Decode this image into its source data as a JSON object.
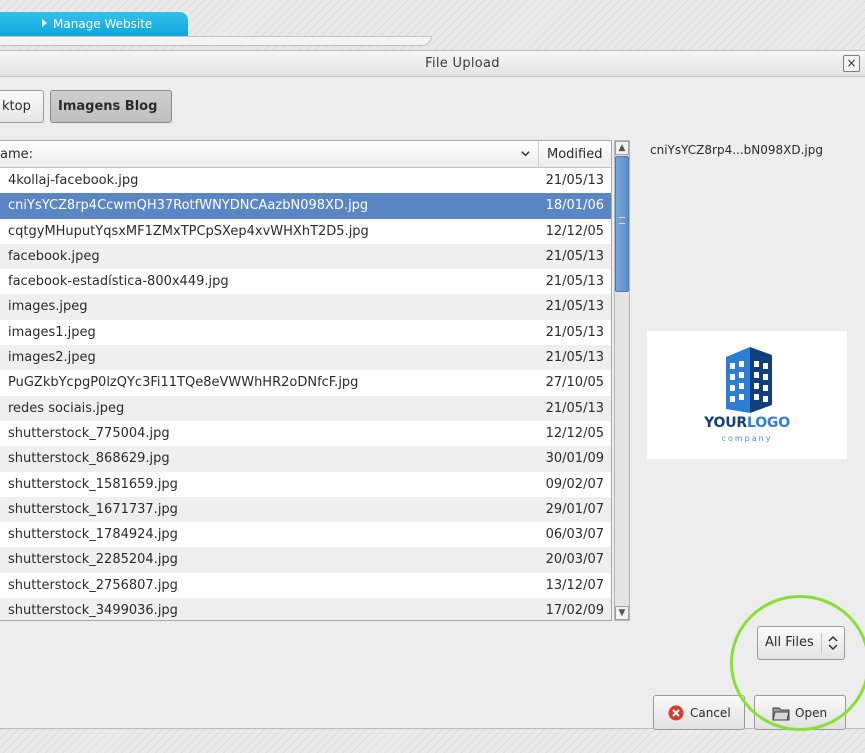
{
  "browser": {
    "tab_label": "Manage Website"
  },
  "dialog": {
    "title": "File Upload",
    "close_glyph": "×"
  },
  "path_bar": {
    "items": [
      {
        "label": "ktop"
      },
      {
        "label": "Imagens Blog"
      }
    ]
  },
  "file_list": {
    "columns": {
      "name": "ame:",
      "modified": "Modified"
    },
    "rows": [
      {
        "name": "4kollaj-facebook.jpg",
        "modified": "21/05/13"
      },
      {
        "name": "cniYsYCZ8rp4CcwmQH37RotfWNYDNCAazbN098XD.jpg",
        "modified": "18/01/06"
      },
      {
        "name": "cqtgyMHuputYqsxMF1ZMxTPCpSXep4xvWHXhT2D5.jpg",
        "modified": "12/12/05"
      },
      {
        "name": "facebook.jpeg",
        "modified": "21/05/13"
      },
      {
        "name": "facebook-estadística-800x449.jpg",
        "modified": "21/05/13"
      },
      {
        "name": "images.jpeg",
        "modified": "21/05/13"
      },
      {
        "name": "images1.jpeg",
        "modified": "21/05/13"
      },
      {
        "name": "images2.jpeg",
        "modified": "21/05/13"
      },
      {
        "name": "PuGZkbYcpgP0lzQYc3Fi11TQe8eVWWhHR2oDNfcF.jpg",
        "modified": "27/10/05"
      },
      {
        "name": "redes sociais.jpeg",
        "modified": "21/05/13"
      },
      {
        "name": "shutterstock_775004.jpg",
        "modified": "12/12/05"
      },
      {
        "name": "shutterstock_868629.jpg",
        "modified": "30/01/09"
      },
      {
        "name": "shutterstock_1581659.jpg",
        "modified": "09/02/07"
      },
      {
        "name": "shutterstock_1671737.jpg",
        "modified": "29/01/07"
      },
      {
        "name": "shutterstock_1784924.jpg",
        "modified": "06/03/07"
      },
      {
        "name": "shutterstock_2285204.jpg",
        "modified": "20/03/07"
      },
      {
        "name": "shutterstock_2756807.jpg",
        "modified": "13/12/07"
      },
      {
        "name": "shutterstock_3499036.jpg",
        "modified": "17/02/09"
      }
    ]
  },
  "preview": {
    "filename": "cniYsYCZ8rp4...bN098XD.jpg",
    "logo_main_a": "YOUR",
    "logo_main_b": "LOGO",
    "logo_sub": "company"
  },
  "filter": {
    "selected": "All Files"
  },
  "buttons": {
    "cancel": "Cancel",
    "open": "Open"
  },
  "colors": {
    "tab": "#1aaee2",
    "selection": "#5b86c4",
    "highlight_ring": "#88e034",
    "cancel_icon": "#d93a2e"
  },
  "icons": {
    "sort": "chevron-down-icon",
    "cancel": "cancel-circle-icon",
    "open": "folder-open-icon",
    "filter": "up-down-arrows-icon"
  }
}
